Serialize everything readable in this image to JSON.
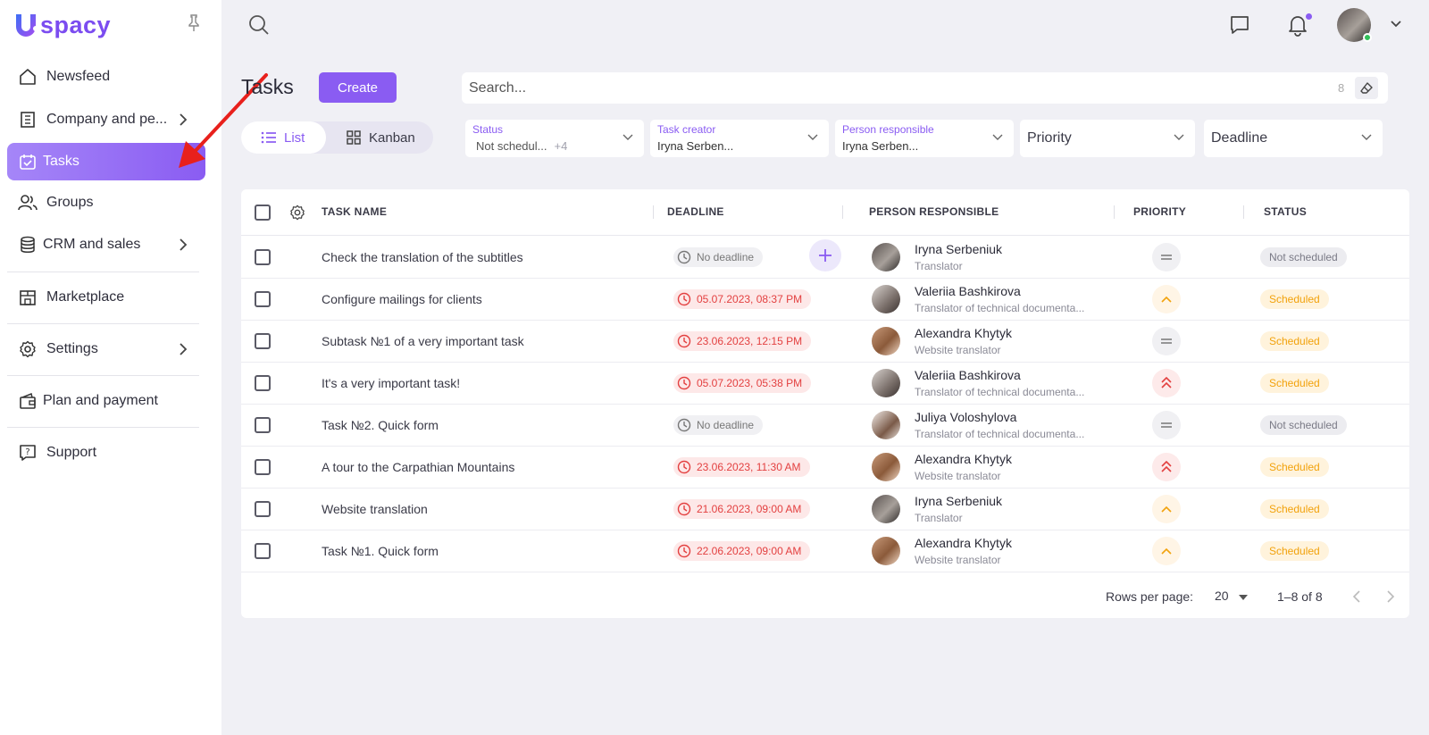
{
  "app": {
    "logo_text": "spacy"
  },
  "sidebar": {
    "items": [
      {
        "label": "Newsfeed",
        "icon": "home-icon"
      },
      {
        "label": "Company and pe...",
        "icon": "building-icon"
      },
      {
        "label": "Tasks",
        "icon": "calendar-check-icon"
      },
      {
        "label": "Groups",
        "icon": "people-icon"
      },
      {
        "label": "CRM and sales",
        "icon": "database-icon"
      },
      {
        "label": "Marketplace",
        "icon": "store-icon"
      },
      {
        "label": "Settings",
        "icon": "gear-icon"
      },
      {
        "label": "Plan and payment",
        "icon": "wallet-icon"
      },
      {
        "label": "Support",
        "icon": "help-chat-icon"
      }
    ]
  },
  "header": {
    "title": "Tasks",
    "create_label": "Create",
    "view_list": "List",
    "view_kanban": "Kanban",
    "search_placeholder": "Search...",
    "search_count": "8"
  },
  "filters": {
    "status": {
      "label": "Status",
      "value": "Not schedul...",
      "more": "+4"
    },
    "task_creator": {
      "label": "Task creator",
      "value": "Iryna Serben..."
    },
    "person_responsible": {
      "label": "Person responsible",
      "value": "Iryna Serben..."
    },
    "priority": {
      "label": "Priority"
    },
    "deadline": {
      "label": "Deadline"
    }
  },
  "table": {
    "columns": [
      "TASK NAME",
      "DEADLINE",
      "PERSON RESPONSIBLE",
      "PRIORITY",
      "STATUS"
    ],
    "rows": [
      {
        "task": "Check the translation of the subtitles",
        "deadline": "No deadline",
        "deadline_type": "none",
        "person": "Iryna Serbeniuk",
        "role": "Translator",
        "priority": "medium",
        "status": "Not scheduled"
      },
      {
        "task": "Configure mailings for clients",
        "deadline": "05.07.2023, 08:37 PM",
        "deadline_type": "late",
        "person": "Valeriia Bashkirova",
        "role": "Translator of technical documenta...",
        "priority": "high",
        "status": "Scheduled"
      },
      {
        "task": "Subtask №1 of a very important task",
        "deadline": "23.06.2023, 12:15 PM",
        "deadline_type": "late",
        "person": "Alexandra Khytyk",
        "role": "Website translator",
        "priority": "medium",
        "status": "Scheduled"
      },
      {
        "task": "It's a very important task!",
        "deadline": "05.07.2023, 05:38 PM",
        "deadline_type": "late",
        "person": "Valeriia Bashkirova",
        "role": "Translator of technical documenta...",
        "priority": "critical",
        "status": "Scheduled"
      },
      {
        "task": "Task №2. Quick form",
        "deadline": "No deadline",
        "deadline_type": "none",
        "person": "Juliya Voloshylova",
        "role": "Translator of technical documenta...",
        "priority": "medium",
        "status": "Not scheduled"
      },
      {
        "task": "A tour to the Carpathian Mountains",
        "deadline": "23.06.2023, 11:30 AM",
        "deadline_type": "late",
        "person": "Alexandra Khytyk",
        "role": "Website translator",
        "priority": "critical",
        "status": "Scheduled"
      },
      {
        "task": "Website translation",
        "deadline": "21.06.2023, 09:00 AM",
        "deadline_type": "late",
        "person": "Iryna Serbeniuk",
        "role": "Translator",
        "priority": "high",
        "status": "Scheduled"
      },
      {
        "task": "Task №1. Quick form",
        "deadline": "22.06.2023, 09:00 AM",
        "deadline_type": "late",
        "person": "Alexandra Khytyk",
        "role": "Website translator",
        "priority": "high",
        "status": "Scheduled"
      }
    ]
  },
  "pagination": {
    "rows_per_page_label": "Rows per page:",
    "rows_per_page": "20",
    "range": "1–8 of 8"
  },
  "colors": {
    "accent": "#8a5cf2",
    "late": "#e34040",
    "scheduled": "#f2a20c",
    "annotation": "#e8201c"
  }
}
